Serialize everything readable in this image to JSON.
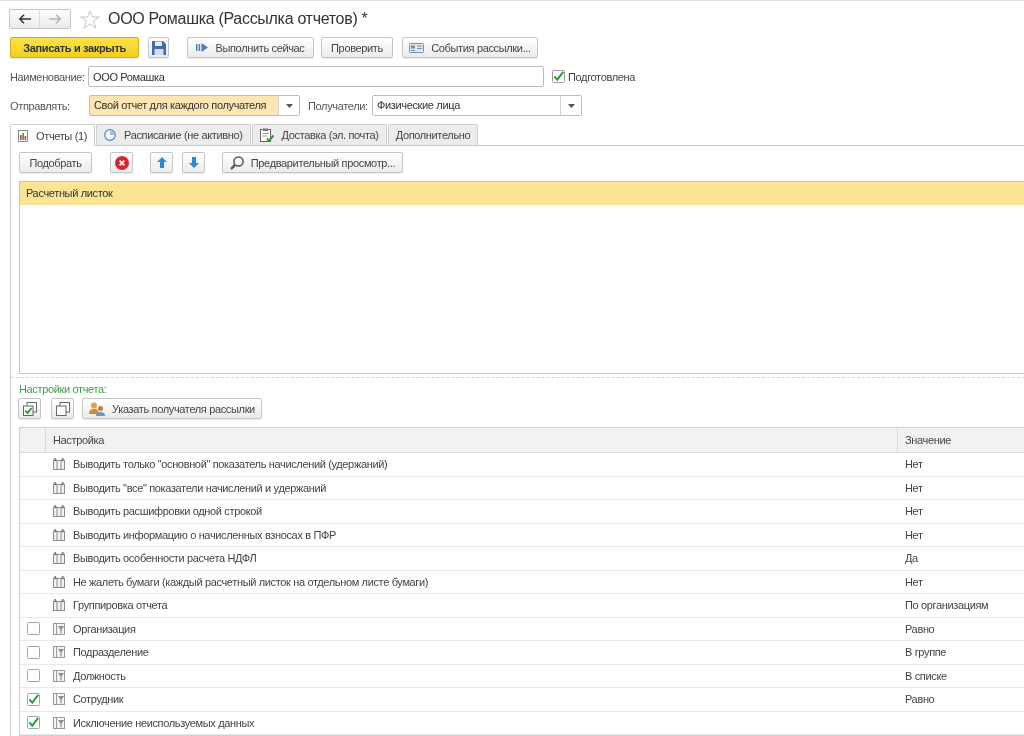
{
  "nav": {
    "back": {
      "disabled": false
    },
    "forward": {
      "disabled": true
    },
    "starred": false
  },
  "window": {
    "title": "ООО Ромашка (Рассылка отчетов) *"
  },
  "toolbar": {
    "save_close": "Записать и закрыть",
    "run_now": "Выполнить сейчас",
    "check": "Проверить",
    "events": "События рассылки..."
  },
  "form": {
    "name_label": "Наименование:",
    "name_value": "ООО Ромашка",
    "prepared": {
      "label": "Подготовлена",
      "checked": true
    },
    "send_label": "Отправлять:",
    "send": {
      "value": "Свой отчет для каждого получателя",
      "highlighted": true
    },
    "recipients_label": "Получатели:",
    "recipients": {
      "value": "Физические лица",
      "highlighted": false
    }
  },
  "tabs": [
    {
      "label": "Отчеты (1)",
      "selected": true
    },
    {
      "label": "Расписание (не активно)",
      "selected": false
    },
    {
      "label": "Доставка (эл. почта)",
      "selected": false
    },
    {
      "label": "Дополнительно",
      "selected": false
    }
  ],
  "reports_toolbar": {
    "pick": "Подобрать",
    "preview": "Предварительный просмотр..."
  },
  "reports": [
    {
      "name": "Расчетный листок",
      "selected": true
    }
  ],
  "settings": {
    "title": "Настройки отчета:",
    "recipient_button": "Указать получателя рассылки",
    "columns": [
      "Настройка",
      "Значение"
    ],
    "rows": [
      {
        "kind": "parameter",
        "name": "Выводить только \"основной\" показатель начислений (удержаний)",
        "value": "Нет"
      },
      {
        "kind": "parameter",
        "name": "Выводить \"все\" показатели начислений и удержаний",
        "value": "Нет"
      },
      {
        "kind": "parameter",
        "name": "Выводить расшифровки одной строкой",
        "value": "Нет"
      },
      {
        "kind": "parameter",
        "name": "Выводить информацию о начисленных взносах в ПФР",
        "value": "Нет"
      },
      {
        "kind": "parameter",
        "name": "Выводить особенности расчета НДФЛ",
        "value": "Да"
      },
      {
        "kind": "parameter",
        "name": "Не жалеть бумаги (каждый расчетный листок на отдельном листе бумаги)",
        "value": "Нет"
      },
      {
        "kind": "parameter",
        "name": "Группировка отчета",
        "value": "По организациям"
      },
      {
        "kind": "filter",
        "checked": false,
        "name": "Организация",
        "value": "Равно"
      },
      {
        "kind": "filter",
        "checked": false,
        "name": "Подразделение",
        "value": "В группе"
      },
      {
        "kind": "filter",
        "checked": false,
        "name": "Должность",
        "value": "В списке"
      },
      {
        "kind": "filter",
        "checked": true,
        "name": "Сотрудник",
        "value": "Равно"
      },
      {
        "kind": "filter",
        "checked": true,
        "name": "Исключение неиспользуемых данных"
      }
    ]
  }
}
